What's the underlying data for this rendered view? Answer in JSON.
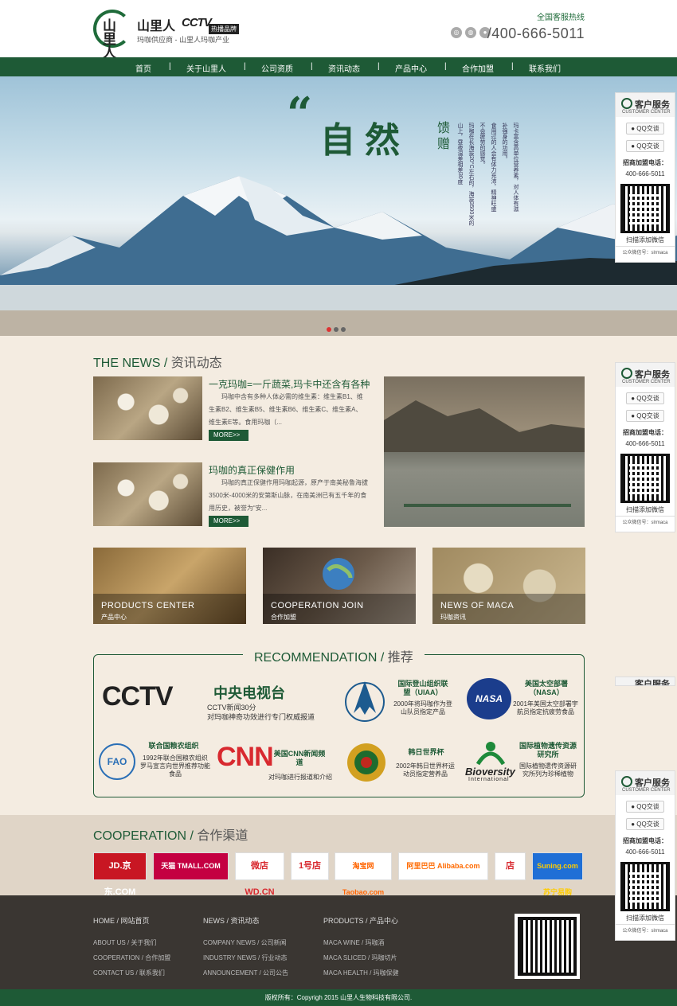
{
  "header": {
    "brand": "山里人",
    "logo_mark": "山里人",
    "cctv": "CCTV",
    "cctv_badge": "热播品牌",
    "slogan": "玛咖供应商 - 山里人玛咖产业",
    "hotline_label": "全国客服热线",
    "phone": "400-666-5011"
  },
  "nav": [
    "首页",
    "关于山里人",
    "公司资质",
    "资讯动态",
    "产品中心",
    "合作加盟",
    "联系我们"
  ],
  "banner": {
    "quote": "“",
    "title": "自然",
    "gift": "馈赠",
    "col1": "山上，昼夜温差相差30度",
    "col2": "玛咖在长海拔20°C左右的，海拔3500米的",
    "col3": "不会疲劳的感觉。",
    "col4": "食用过的人会有体力充沛，精神旺盛",
    "col5": "补强身的功用。",
    "col6": "玛卡富含高单位营养素，对人体有滋"
  },
  "side": {
    "title": "客户服务",
    "subtitle": "CUSTOMER CENTER",
    "qq": "QQ交谈",
    "label": "招商加盟电话：",
    "phone": "400-666-5011",
    "scan": "扫描添加微信",
    "wechat": "公众微信号：slrmaca"
  },
  "news": {
    "title_en": "THE NEWS",
    "title_cn": "资讯动态",
    "items": [
      {
        "title": "一克玛咖=一斤蔬菜,玛卡中还含有各种",
        "desc": "玛咖中含有多种人体必需的维生素：维生素B1、维生素B2、维生素B5、维生素B6、维生素C、维生素A、维生素E等。食用玛咖（...",
        "more": "MORE>>"
      },
      {
        "title": "玛咖的真正保健作用",
        "desc": "玛咖的真正保健作用玛咖起源，原产于南美秘鲁海拔3500米-4000米的安第斯山脉，在南美洲已有五千年的食用历史，被誉为“安...",
        "more": "MORE>>"
      }
    ]
  },
  "cards": [
    {
      "en": "PRODUCTS CENTER",
      "cn": "产品中心"
    },
    {
      "en": "COOPERATION JOIN",
      "cn": "合作加盟"
    },
    {
      "en": "NEWS OF MACA",
      "cn": "玛咖资讯"
    }
  ],
  "recommend": {
    "title_en": "RECOMMENDATION",
    "title_cn": "推荐",
    "cctv_logo": "CCTV",
    "cctv_title": "中央电视台",
    "cctv_desc1": "CCTV新闻30分",
    "cctv_desc2": "对玛咖神奇功效进行专门权威报道",
    "uiaa_title": "国际登山组织联盟（UIAA）",
    "uiaa_desc": "2000年将玛咖作为登山队员指定产品",
    "nasa_logo": "NASA",
    "nasa_title": "美国太空部署（NASA）",
    "nasa_desc": "2001年美国太空部署宇航员指定抗疲劳食品",
    "fao_logo": "FAO",
    "fao_title": "联合国粮农组织",
    "fao_desc": "1992年联合国粮农组织罗马宣言向世界推荐功能食品",
    "cnn_logo": "CNN",
    "cnn_title": "美国CNN新闻频道",
    "cnn_desc": "对玛咖进行报道和介绍",
    "wc_title": "韩日世界杯",
    "wc_desc": "2002年韩日世界杯运动员指定营养品",
    "bio_logo": "Bioversity",
    "bio_logo2": "International",
    "bio_title": "国际植物遗传资源研究所",
    "bio_desc": "国际植物遗传资源研究所列为珍稀植物"
  },
  "coop": {
    "title_en": "COOPERATION",
    "title_cn": "合作渠道",
    "shops": [
      {
        "label": "JD.京东.COM",
        "bg": "#c81623",
        "fg": "#ffffff"
      },
      {
        "label": "天猫 TMALL.COM",
        "bg": "#c40041",
        "fg": "#ffffff"
      },
      {
        "label": "微店 WD.CN",
        "bg": "#ffffff",
        "fg": "#d8292f"
      },
      {
        "label": "1号店",
        "bg": "#ffffff",
        "fg": "#d8292f"
      },
      {
        "label": "淘宝网 Taobao.com",
        "bg": "#ffffff",
        "fg": "#ff6400"
      },
      {
        "label": "阿里巴巴 Alibaba.com",
        "bg": "#ffffff",
        "fg": "#ff6a00"
      },
      {
        "label": "店",
        "bg": "#ffffff",
        "fg": "#d8292f"
      },
      {
        "label": "Suning.com 苏宁易购",
        "bg": "#1f6fd6",
        "fg": "#ffcc00"
      }
    ]
  },
  "footer": {
    "col1": {
      "head": "HOME / 网站首页",
      "links": [
        "ABOUT US / 关于我们",
        "COOPERATION / 合作加盟",
        "CONTACT US / 联系我们"
      ]
    },
    "col2": {
      "head": "NEWS / 资讯动态",
      "links": [
        "COMPANY NEWS / 公司新闻",
        "INDUSTRY NEWS / 行业动态",
        "ANNOUNCEMENT / 公司公告"
      ]
    },
    "col3": {
      "head": "PRODUCTS / 产品中心",
      "links": [
        "MACA WINE / 玛咖酒",
        "MACA SLICED / 玛咖切片",
        "MACA HEALTH / 玛咖保健"
      ]
    },
    "copyright": "版权所有：Copyrigh 2015 山里人生物科技有限公司."
  },
  "colors": {
    "brand_green": "#1e5a36",
    "bg": "#f4ece1"
  }
}
